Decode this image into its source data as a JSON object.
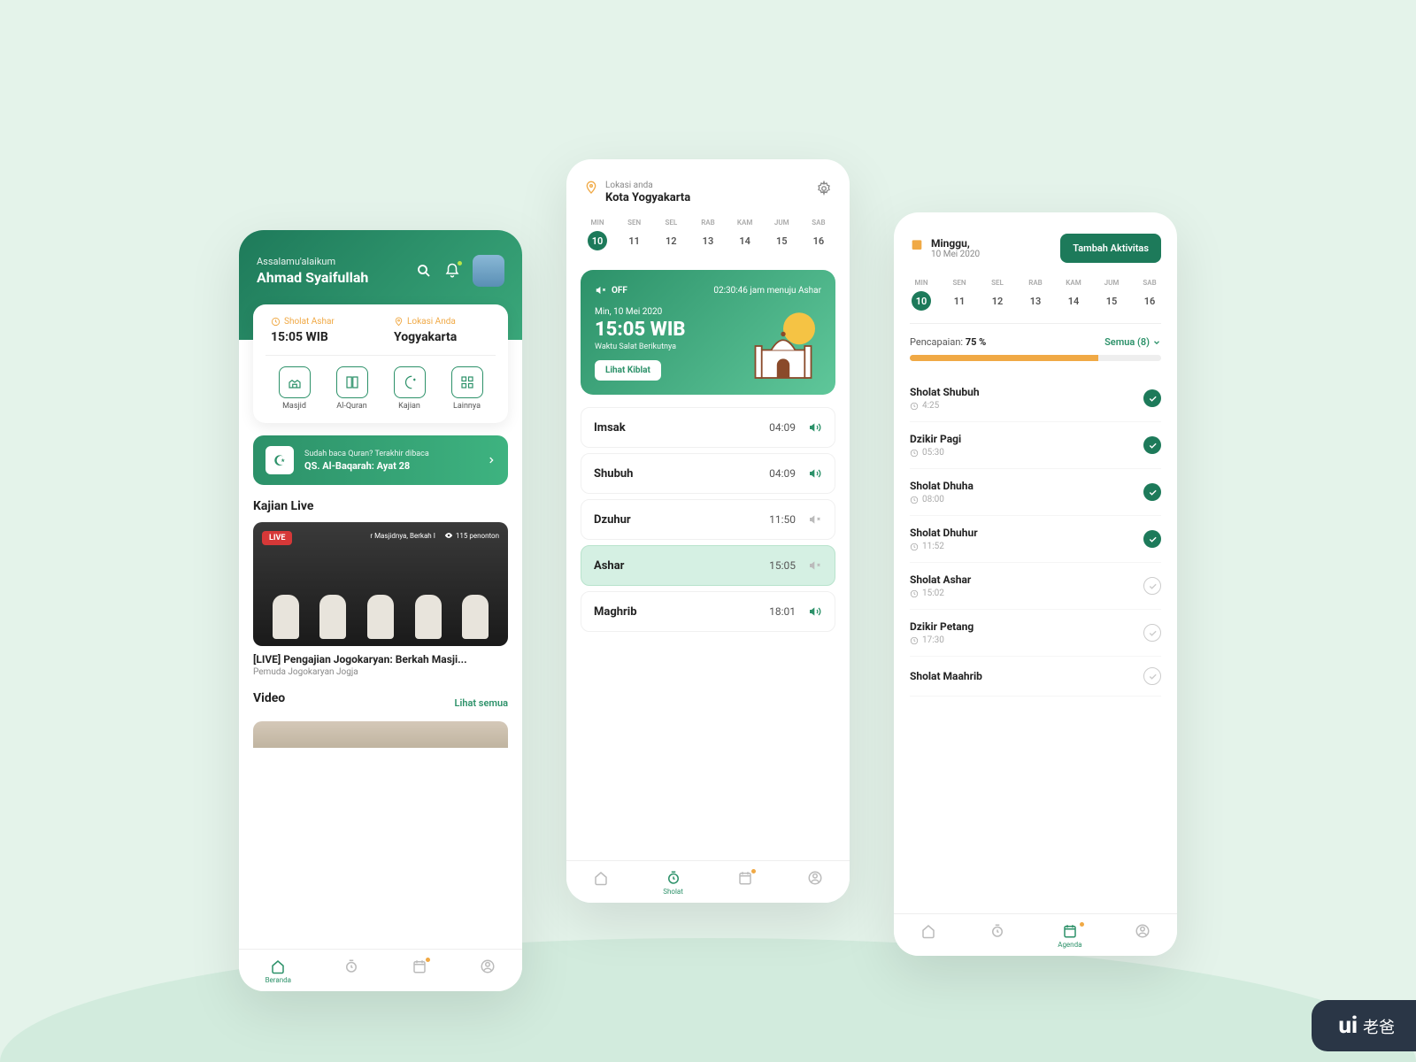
{
  "phone1": {
    "greeting": "Assalamu'alaikum",
    "name": "Ahmad Syaifullah",
    "card": {
      "prayer_label": "Sholat Ashar",
      "prayer_time": "15:05 WIB",
      "location_label": "Lokasi Anda",
      "location_value": "Yogyakarta"
    },
    "shortcuts": [
      "Masjid",
      "Al-Quran",
      "Kajian",
      "Lainnya"
    ],
    "quran": {
      "sub": "Sudah baca Quran? Terakhir dibaca",
      "main": "QS. Al-Baqarah: Ayat 28"
    },
    "kajian_title": "Kajian Live",
    "live": {
      "badge": "LIVE",
      "info": "r Masjidnya, Berkah I",
      "viewers": "115 penonton",
      "title": "[LIVE] Pengajian Jogokaryan: Berkah Masji...",
      "sub": "Pemuda Jogokaryan Jogja"
    },
    "video_title": "Video",
    "see_all": "Lihat semua",
    "nav": [
      "Beranda",
      "",
      "",
      ""
    ]
  },
  "phone2": {
    "location_label": "Lokasi anda",
    "location_value": "Kota Yogyakarta",
    "days_labels": [
      "MIN",
      "SEN",
      "SEL",
      "RAB",
      "KAM",
      "JUM",
      "SAB"
    ],
    "days_nums": [
      "10",
      "11",
      "12",
      "13",
      "14",
      "15",
      "16"
    ],
    "hero": {
      "sound": "OFF",
      "countdown": "02:30:46 jam menuju Ashar",
      "date": "Min, 10 Mei 2020",
      "time": "15:05 WIB",
      "next": "Waktu Salat Berikutnya",
      "kibla": "Lihat Kiblat"
    },
    "times": [
      {
        "name": "Imsak",
        "time": "04:09",
        "muted": false
      },
      {
        "name": "Shubuh",
        "time": "04:09",
        "muted": false
      },
      {
        "name": "Dzuhur",
        "time": "11:50",
        "muted": true
      },
      {
        "name": "Ashar",
        "time": "15:05",
        "muted": true,
        "active": true
      },
      {
        "name": "Maghrib",
        "time": "18:01",
        "muted": false
      }
    ],
    "nav_active": "Sholat"
  },
  "phone3": {
    "date_label": "Minggu,",
    "date_sub": "10 Mei 2020",
    "button": "Tambah Aktivitas",
    "days_labels": [
      "MIN",
      "SEN",
      "SEL",
      "RAB",
      "KAM",
      "JUM",
      "SAB"
    ],
    "days_nums": [
      "10",
      "11",
      "12",
      "13",
      "14",
      "15",
      "16"
    ],
    "ach_label": "Pencapaian:",
    "ach_value": "75 %",
    "filter": "Semua (8)",
    "tasks": [
      {
        "name": "Sholat Shubuh",
        "time": "4:25",
        "done": true
      },
      {
        "name": "Dzikir Pagi",
        "time": "05:30",
        "done": true
      },
      {
        "name": "Sholat Dhuha",
        "time": "08:00",
        "done": true
      },
      {
        "name": "Sholat Dhuhur",
        "time": "11:52",
        "done": true
      },
      {
        "name": "Sholat Ashar",
        "time": "15:02",
        "done": false
      },
      {
        "name": "Dzikir Petang",
        "time": "17:30",
        "done": false
      },
      {
        "name": "Sholat Maahrib",
        "time": "",
        "done": false
      }
    ],
    "nav_active": "Agenda"
  },
  "watermark": {
    "bold": "ui",
    "rest": "老爸"
  }
}
